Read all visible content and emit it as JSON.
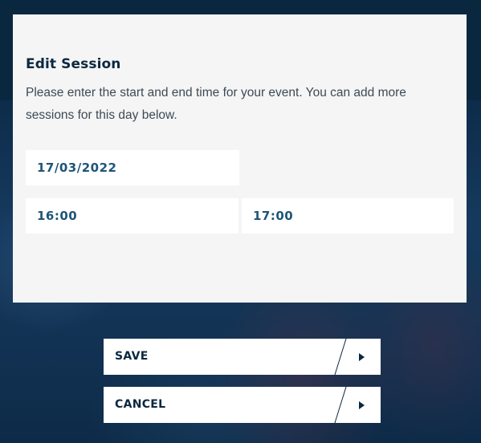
{
  "modal": {
    "title": "Edit Session",
    "description": "Please enter the start and end time for your event. You can add more sessions for this day below."
  },
  "session": {
    "date": "17/03/2022",
    "start_time": "16:00",
    "end_time": "17:00"
  },
  "actions": {
    "save_label": "SAVE",
    "cancel_label": "CANCEL"
  },
  "colors": {
    "backdrop": "#0f2f4f",
    "panel": "#f5f5f5",
    "field_text": "#1e5577",
    "title_text": "#0c2840"
  },
  "icons": {
    "button_arrow": "triangle-right-icon"
  }
}
